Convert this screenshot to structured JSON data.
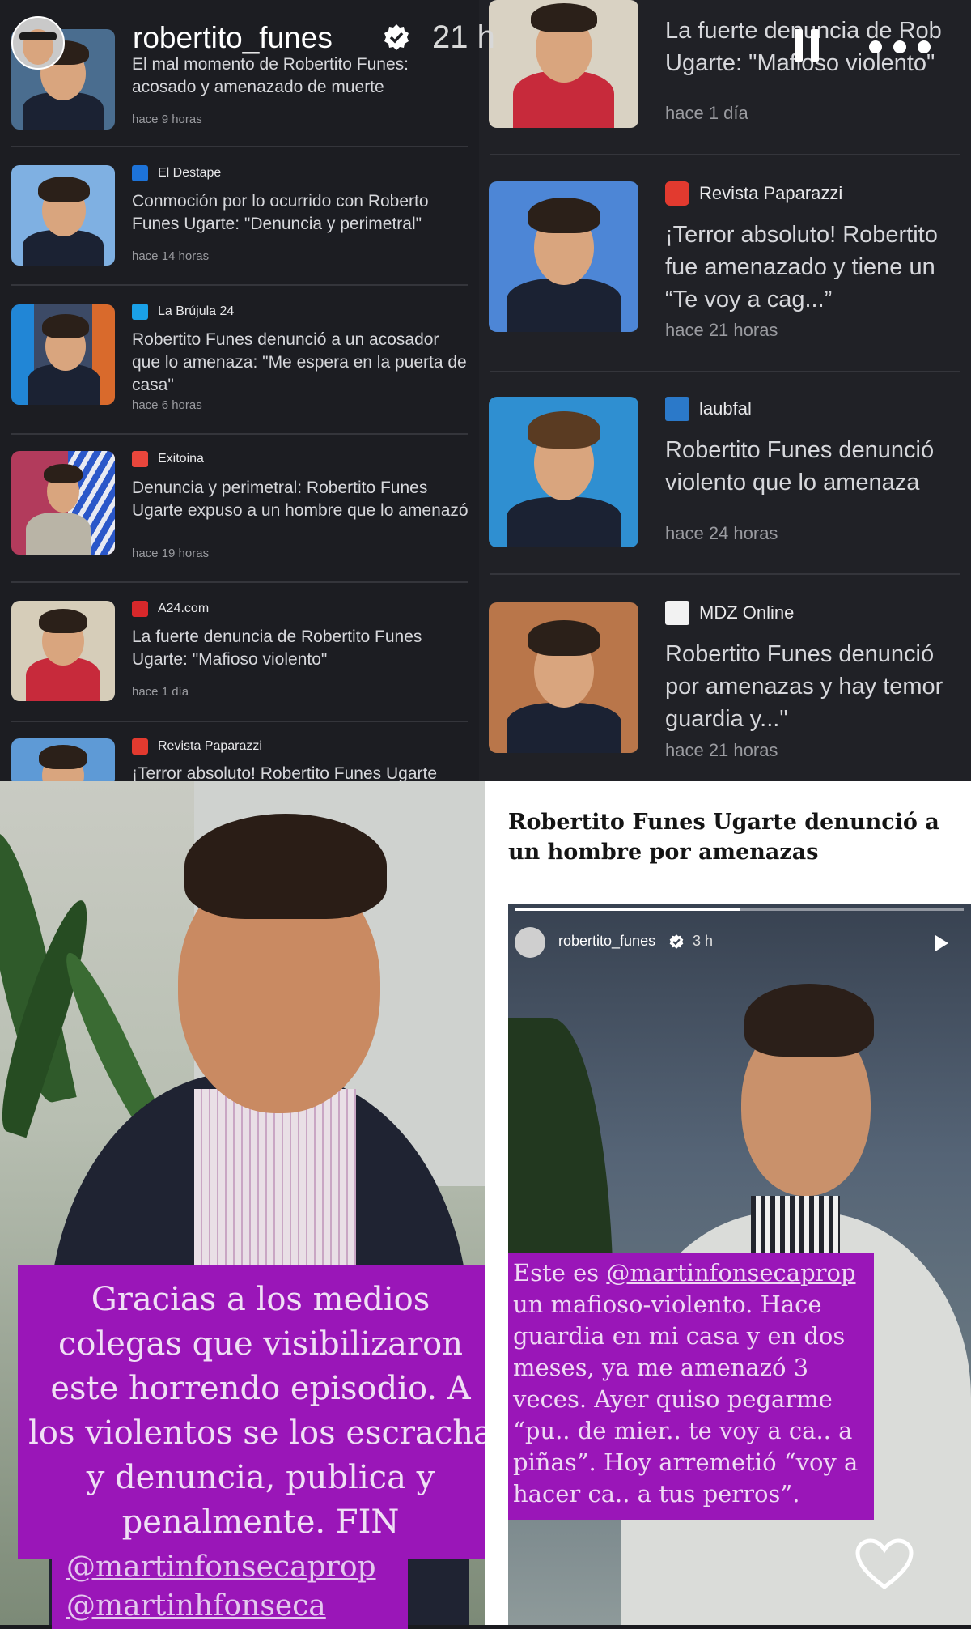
{
  "story": {
    "username": "robertito_funes",
    "time": "21 h"
  },
  "left_feed": [
    {
      "source": "",
      "headline": "El mal momento de Robertito Funes: acosado y amenazado de muerte",
      "time": "hace 9 horas",
      "icon_color": "#1d73d9"
    },
    {
      "source": "El Destape",
      "headline": "Conmoción por lo ocurrido con Roberto Funes Ugarte: \"Denuncia y perimetral\"",
      "time": "hace 14 horas",
      "icon_color": "#1d73d9"
    },
    {
      "source": "La Brújula 24",
      "headline": "Robertito Funes denunció a un acosador que lo amenaza: \"Me espera en la puerta de casa\"",
      "time": "hace 6 horas",
      "icon_color": "#1aa1e8"
    },
    {
      "source": "Exitoina",
      "headline": "Denuncia y perimetral: Robertito Funes Ugarte expuso a un hombre que lo amenazó",
      "time": "hace 19 horas",
      "icon_color": "#e8463c"
    },
    {
      "source": "A24.com",
      "headline": "La fuerte denuncia de Robertito Funes Ugarte: \"Mafioso violento\"",
      "time": "hace 1 día",
      "icon_color": "#d8282b"
    },
    {
      "source": "Revista Paparazzi",
      "headline": "¡Terror absoluto! Robertito Funes Ugarte",
      "time": "",
      "icon_color": "#e23a2f"
    }
  ],
  "right_feed": [
    {
      "source": "",
      "headline_lines": [
        "La fuerte denuncia de Rob",
        "Ugarte: \"Mafioso violento\""
      ],
      "time": "hace 1 día",
      "icon_color": "#d8282b"
    },
    {
      "source": "Revista Paparazzi",
      "headline_lines": [
        "¡Terror absoluto! Robertito",
        "fue amenazado y tiene un",
        "“Te voy a cag...”"
      ],
      "time": "hace 21 horas",
      "icon_color": "#e23a2f"
    },
    {
      "source": "laubfal",
      "headline_lines": [
        "Robertito Funes denunció",
        "violento que lo amenaza"
      ],
      "time": "hace 24 horas",
      "icon_color": "#2b79c9"
    },
    {
      "source": "MDZ Online",
      "headline_lines": [
        "Robertito Funes denunció",
        "por amenazas y hay temor",
        "guardia y...\""
      ],
      "time": "hace 21 horas",
      "icon_color": "#f2f2f2"
    }
  ],
  "caption_left": {
    "text": "Gracias a los medios colegas que visibilizaron este horrendo episodio. A los violentos se los escracha y denuncia, publica y penalmente. FIN",
    "mentions": [
      "@martinfonsecaprop",
      "@martinhfonseca"
    ],
    "bg_color": "#9a16b8"
  },
  "article_right": {
    "title": "Robertito Funes Ugarte denunció a un hombre por amenazas",
    "embedded": {
      "username": "robertito_funes",
      "time": "3 h",
      "progress": 0.5
    },
    "caption": {
      "mention": "@martinfonsecaprop",
      "text_lead": "Este es",
      "text_rest": "un mafioso-violento. Hace guardia en mi casa y en dos meses, ya me amenazó 3 veces. Ayer quiso pegarme “pu.. de mier.. te voy a ca.. a piñas”. Hoy arremetió “voy a hacer ca.. a tus perros”."
    }
  }
}
